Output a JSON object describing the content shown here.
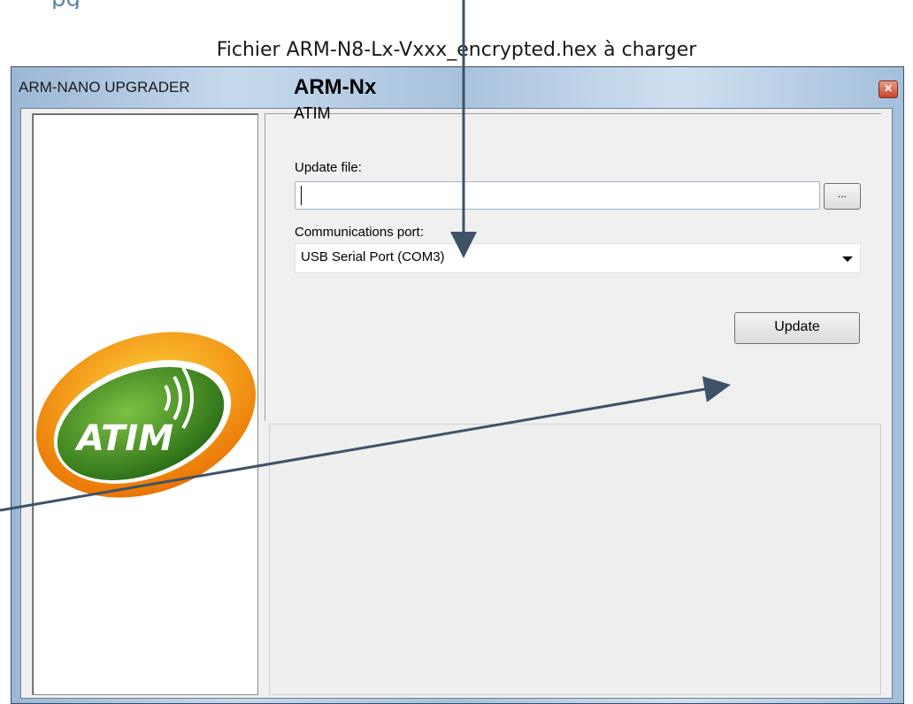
{
  "document": {
    "heading_fragment": "pg",
    "caption": "Fichier ARM-N8-Lx-Vxxx_encrypted.hex à charger"
  },
  "window": {
    "title": "ARM-NANO UPGRADER",
    "close_icon": "close-icon"
  },
  "logo": {
    "text": "ATIM",
    "colors": {
      "outer": "#f08c00",
      "inner": "#3a8a1f"
    }
  },
  "form": {
    "product_name": "ARM-Nx",
    "company_name": "ATIM",
    "update_file_label": "Update file:",
    "update_file_value": "",
    "browse_label": "...",
    "port_label": "Communications port:",
    "port_value": "USB Serial Port (COM3)",
    "update_button": "Update"
  },
  "colors": {
    "arrow": "#3e5268",
    "window_frame": "#b8cde3"
  }
}
